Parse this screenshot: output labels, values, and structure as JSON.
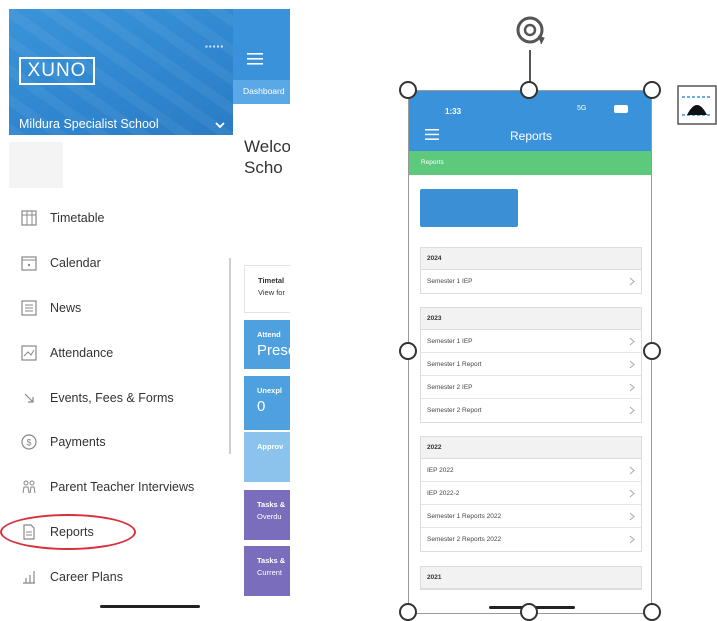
{
  "left_app": {
    "logo": "XUNO",
    "school_name": "Mildura Specialist School",
    "dashboard_crumb": "Dashboard",
    "welcome_line1": "Welco",
    "welcome_line2": "Scho",
    "nav": [
      {
        "label": "Timetable",
        "icon": "timetable-icon"
      },
      {
        "label": "Calendar",
        "icon": "calendar-icon"
      },
      {
        "label": "News",
        "icon": "news-icon"
      },
      {
        "label": "Attendance",
        "icon": "attendance-icon"
      },
      {
        "label": "Events, Fees & Forms",
        "icon": "arrow-icon"
      },
      {
        "label": "Payments",
        "icon": "dollar-icon"
      },
      {
        "label": "Parent Teacher Interviews",
        "icon": "people-icon"
      },
      {
        "label": "Reports",
        "icon": "report-icon"
      },
      {
        "label": "Career Plans",
        "icon": "career-icon"
      }
    ],
    "cards": [
      {
        "t1": "Timetal",
        "t2": "View for"
      },
      {
        "t1": "Attend",
        "t2": "Prese"
      },
      {
        "t1": "Unexpl",
        "t2": "0"
      },
      {
        "t1": "Approv",
        "t2": ""
      },
      {
        "t1": "Tasks &",
        "t2": "Overdu"
      },
      {
        "t1": "Tasks &",
        "t2": "Current"
      }
    ],
    "colors": {
      "header": "#3b94d9",
      "highlight": "#d92f3a",
      "purple": "#7a6dbb"
    }
  },
  "right_app": {
    "time": "1:33",
    "status": "5G",
    "battery": "",
    "title": "Reports",
    "breadcrumb": "Reports",
    "groups": [
      {
        "year": "2024",
        "rows": [
          "Semester 1 IEP"
        ]
      },
      {
        "year": "2023",
        "rows": [
          "Semester 1 IEP",
          "Semester 1 Report",
          "Semester 2 IEP",
          "Semester 2 Report"
        ]
      },
      {
        "year": "2022",
        "rows": [
          "IEP 2022",
          "IEP 2022-2",
          "Semester 1 Reports 2022",
          "Semester 2 Reports 2022"
        ]
      },
      {
        "year": "2021",
        "rows": []
      }
    ],
    "colors": {
      "header": "#3a93da",
      "crumb": "#5dc97d",
      "button": "#3b8fd4"
    }
  }
}
